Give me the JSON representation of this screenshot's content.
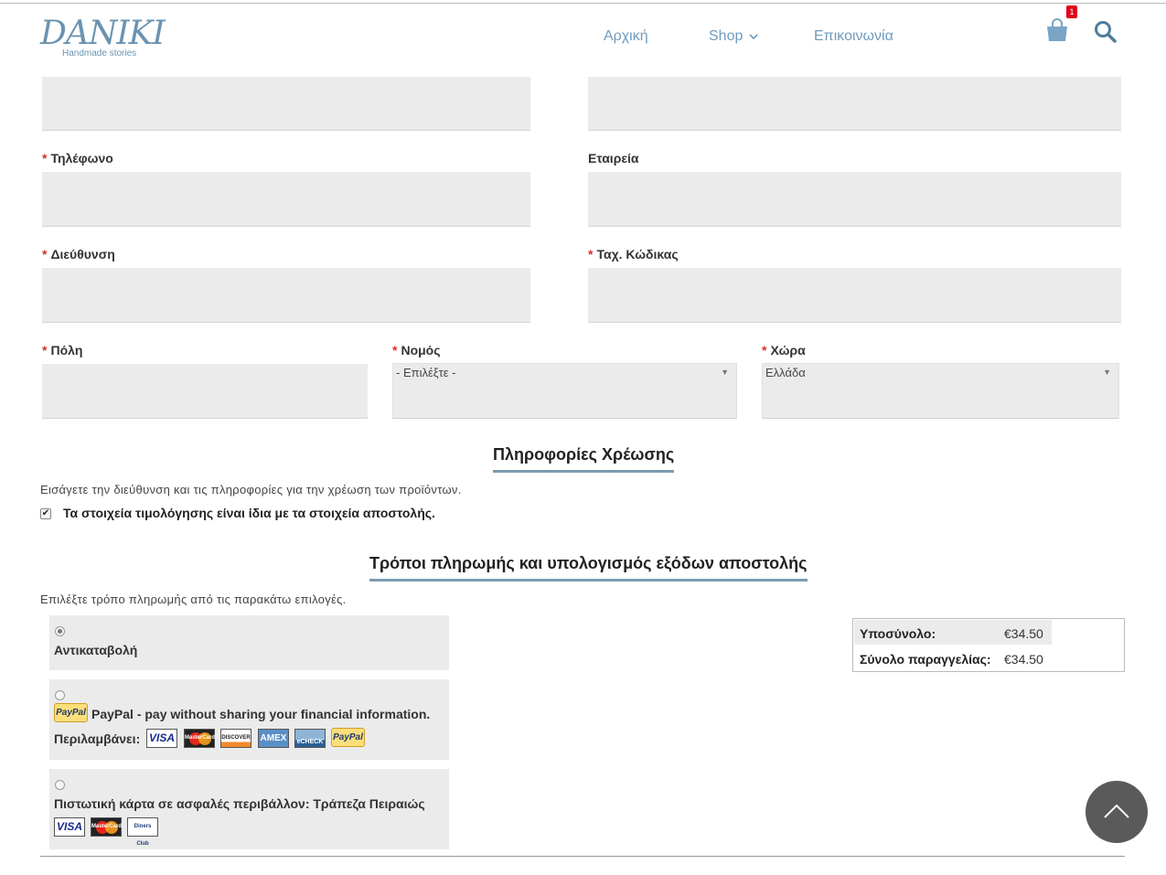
{
  "header": {
    "logo_text": "DANIKI",
    "logo_subtitle": "Handmade stories",
    "nav": {
      "home": "Αρχική",
      "shop": "Shop",
      "contact": "Επικοινωνία"
    },
    "cart_count": "1",
    "icons": [
      "cart-icon",
      "search-icon",
      "chevron-down-icon"
    ]
  },
  "form": {
    "phone_label": "Τηλέφωνο",
    "company_label": "Εταιρεία",
    "address_label": "Διεύθυνση",
    "postcode_label": "Ταχ. Κώδικας",
    "city_label": "Πόλη",
    "prefecture_label": "Νομός",
    "prefecture_value": "- Επιλέξτε -",
    "country_label": "Χώρα",
    "country_value": "Ελλάδα",
    "required_mark": "*"
  },
  "billing": {
    "title": "Πληροφορίες Χρέωσης",
    "description": "Εισάγετε την διεύθυνση και τις πληροφορίες για την χρέωση των προϊόντων.",
    "same_as_shipping_label": "Τα στοιχεία τιμολόγησης είναι ίδια με τα στοιχεία αποστολής.",
    "same_as_shipping_checked": true
  },
  "payment": {
    "title": "Τρόποι πληρωμής και υπολογισμός εξόδων αποστολής",
    "description": "Επιλέξτε τρόπο πληρωμής από τις παρακάτω επιλογές.",
    "options": [
      {
        "label": "Αντικαταβολή",
        "selected": true
      },
      {
        "label": "PayPal - pay without sharing your financial information.",
        "includes_label": "Περιλαμβάνει:",
        "selected": false
      },
      {
        "label": "Πιστωτική κάρτα σε ασφαλές περιβάλλον: Τράπεζα Πειραιώς",
        "selected": false
      }
    ],
    "card_logos": {
      "visa": "VISA",
      "mastercard": "MasterCard",
      "discover": "DISCOVER",
      "amex": "AMEX",
      "echeck": "eCHECK",
      "paypal": "PayPal",
      "diners": "Diners Club"
    }
  },
  "totals": {
    "subtotal_label": "Υποσύνολο:",
    "subtotal_value": "€34.50",
    "total_label": "Σύνολο παραγγελίας:",
    "total_value": "€34.50"
  }
}
